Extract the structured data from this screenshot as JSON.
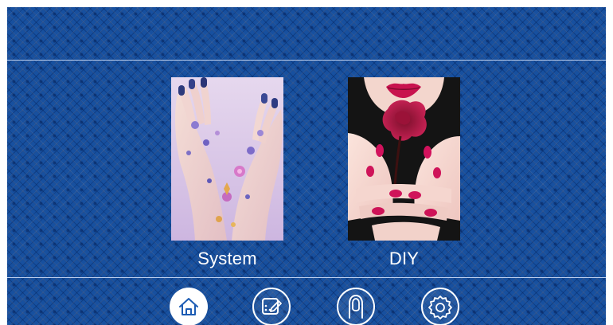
{
  "modes": [
    {
      "id": "system",
      "label": "System",
      "image": "nail-art-hands-purple-floral"
    },
    {
      "id": "diy",
      "label": "DIY",
      "image": "red-nails-holding-rose"
    }
  ],
  "nav": {
    "items": [
      {
        "id": "home",
        "icon": "home-icon",
        "active": true
      },
      {
        "id": "diy",
        "icon": "diy-edit-icon",
        "active": false
      },
      {
        "id": "nail",
        "icon": "fingernail-icon",
        "active": false
      },
      {
        "id": "settings",
        "icon": "gear-icon",
        "active": false
      }
    ]
  },
  "colors": {
    "background": "#17509f",
    "divider": "#dce8ff",
    "active_button": "#ffffff",
    "active_icon": "#1c5cb4",
    "text": "#ffffff"
  }
}
